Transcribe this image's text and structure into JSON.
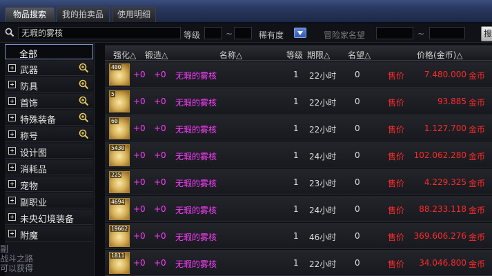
{
  "tabs": [
    {
      "label": "物品搜索",
      "active": true
    },
    {
      "label": "我的拍卖品",
      "active": false
    },
    {
      "label": "使用明细",
      "active": false
    }
  ],
  "search": {
    "value": "无瑕的雾核",
    "level_label": "等级",
    "tilde": "~",
    "rarity_label": "稀有度",
    "adventurer_label": "冒险家名望",
    "button_label": "搜"
  },
  "categories": [
    {
      "label": "全部",
      "selected": true
    },
    {
      "label": "武器",
      "zoom": true
    },
    {
      "label": "防具",
      "zoom": true
    },
    {
      "label": "首饰",
      "zoom": true
    },
    {
      "label": "特殊装备",
      "zoom": true
    },
    {
      "label": "称号",
      "zoom": true
    },
    {
      "label": "设计图",
      "zoom": false
    },
    {
      "label": "消耗品",
      "zoom": false
    },
    {
      "label": "宠物",
      "zoom": false
    },
    {
      "label": "副职业",
      "zoom": false
    },
    {
      "label": "未央幻境装备",
      "zoom": false
    },
    {
      "label": "附魔",
      "zoom": false
    }
  ],
  "columns": {
    "strengthen": "强化△",
    "forge": "锻造△",
    "name": "名称△",
    "level": "等级",
    "duration": "期限△",
    "fame": "名望△",
    "price": "价格(金币)△"
  },
  "listings": [
    {
      "count": "400",
      "strengthen": "+0",
      "forge": "+0",
      "name": "无瑕的雾核",
      "level": "1",
      "duration": "22小时",
      "fame": "0",
      "price_label": "售价",
      "price": "7.480.000",
      "unit": "金币"
    },
    {
      "count": "5",
      "strengthen": "+0",
      "forge": "+0",
      "name": "无瑕的雾核",
      "level": "1",
      "duration": "22小时",
      "fame": "0",
      "price_label": "售价",
      "price": "93.885",
      "unit": "金币"
    },
    {
      "count": "60",
      "strengthen": "+0",
      "forge": "+0",
      "name": "无瑕的雾核",
      "level": "1",
      "duration": "22小时",
      "fame": "0",
      "price_label": "售价",
      "price": "1.127.700",
      "unit": "金币"
    },
    {
      "count": "5430",
      "strengthen": "+0",
      "forge": "+0",
      "name": "无瑕的雾核",
      "level": "1",
      "duration": "24小时",
      "fame": "0",
      "price_label": "售价",
      "price": "102.062.280",
      "unit": "金币"
    },
    {
      "count": "225",
      "strengthen": "+0",
      "forge": "+0",
      "name": "无瑕的雾核",
      "level": "1",
      "duration": "23小时",
      "fame": "0",
      "price_label": "售价",
      "price": "4.229.325",
      "unit": "金币"
    },
    {
      "count": "4694",
      "strengthen": "+0",
      "forge": "+0",
      "name": "无瑕的雾核",
      "level": "1",
      "duration": "24小时",
      "fame": "0",
      "price_label": "售价",
      "price": "88.233.118",
      "unit": "金币"
    },
    {
      "count": "19662",
      "strengthen": "+0",
      "forge": "+0",
      "name": "无瑕的雾核",
      "level": "1",
      "duration": "46小时",
      "fame": "0",
      "price_label": "售价",
      "price": "369.606.276",
      "unit": "金币"
    },
    {
      "count": "1811",
      "strengthen": "+0",
      "forge": "+0",
      "name": "无瑕的雾核",
      "level": "1",
      "duration": "22小时",
      "fame": "0",
      "price_label": "售价",
      "price": "34.046.800",
      "unit": "金币"
    }
  ],
  "overlay_text": [
    "副",
    "战斗之路",
    "可以获得"
  ],
  "colors": {
    "accent": "#ff3cff",
    "price": "#ff2a2a",
    "tab_bar": "#2b3a62"
  }
}
